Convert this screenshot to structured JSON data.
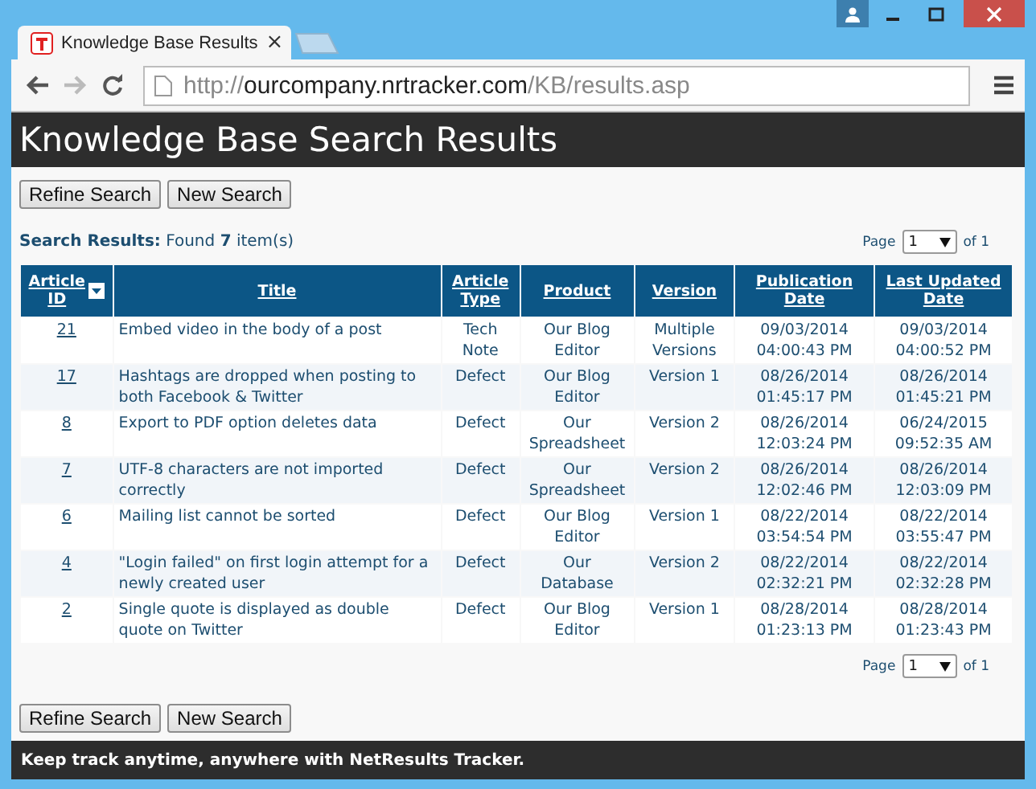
{
  "browser": {
    "tab_title": "Knowledge Base Results",
    "tab_close": "×",
    "url_scheme": "http://",
    "url_host": "ourcompany.nrtracker.com",
    "url_path": "/KB/results.asp"
  },
  "page_title": "Knowledge Base Search Results",
  "top_buttons": [
    "Refine Search",
    "New Search"
  ],
  "summary": "**Search Results:** Found **7** item(s)",
  "pager_top": {
    "label": "Page",
    "value": "1",
    "total": "of 1"
  },
  "table": {
    "columns": [
      {
        "label": "Article ID",
        "sorted": true
      },
      {
        "label": "Title",
        "sorted": false
      },
      {
        "label": "Article Type",
        "sorted": false
      },
      {
        "label": "Product",
        "sorted": false
      },
      {
        "label": "Version",
        "sorted": false
      },
      {
        "label": "Publication Date",
        "sorted": false
      },
      {
        "label": "Last Updated Date",
        "sorted": false
      }
    ],
    "rows": [
      {
        "id": "21",
        "title": "Embed video in the body of a post",
        "type": "Tech Note",
        "product": "Our Blog Editor",
        "version": "Multiple Versions",
        "published": "09/03/2014 04:00:43 PM",
        "updated": "09/03/2014 04:00:52 PM"
      },
      {
        "id": "17",
        "title": "Hashtags are dropped when posting to both Facebook & Twitter",
        "type": "Defect",
        "product": "Our Blog Editor",
        "version": "Version 1",
        "published": "08/26/2014 01:45:17 PM",
        "updated": "08/26/2014 01:45:21 PM"
      },
      {
        "id": "8",
        "title": "Export to PDF option deletes data",
        "type": "Defect",
        "product": "Our Spreadsheet",
        "version": "Version 2",
        "published": "08/26/2014 12:03:24 PM",
        "updated": "06/24/2015 09:52:35 AM"
      },
      {
        "id": "7",
        "title": "UTF-8 characters are not imported correctly",
        "type": "Defect",
        "product": "Our Spreadsheet",
        "version": "Version 2",
        "published": "08/26/2014 12:02:46 PM",
        "updated": "08/26/2014 12:03:09 PM"
      },
      {
        "id": "6",
        "title": "Mailing list cannot be sorted",
        "type": "Defect",
        "product": "Our Blog Editor",
        "version": "Version 1",
        "published": "08/22/2014 03:54:54 PM",
        "updated": "08/22/2014 03:55:47 PM"
      },
      {
        "id": "4",
        "title": "\"Login failed\" on first login attempt for a newly created user",
        "type": "Defect",
        "product": "Our Database",
        "version": "Version 2",
        "published": "08/22/2014 02:32:21 PM",
        "updated": "08/22/2014 02:32:28 PM"
      },
      {
        "id": "2",
        "title": "Single quote is displayed as double quote on Twitter",
        "type": "Defect",
        "product": "Our Blog Editor",
        "version": "Version 1",
        "published": "08/28/2014 01:23:13 PM",
        "updated": "08/28/2014 01:23:43 PM"
      }
    ]
  },
  "pager_bottom": {
    "label": "Page",
    "value": "1",
    "total": "of 1"
  },
  "bottom_buttons": [
    "Refine Search",
    "New Search"
  ],
  "footer": "Keep track anytime, anywhere with NetResults Tracker."
}
